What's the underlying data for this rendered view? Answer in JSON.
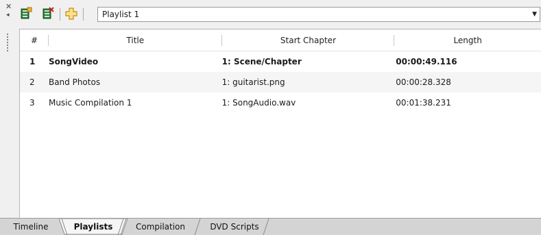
{
  "toolbar": {
    "playlist_select": "Playlist 1",
    "icons": [
      "playlist-add-icon",
      "playlist-remove-icon",
      "add-item-icon"
    ]
  },
  "table": {
    "columns": [
      "#",
      "Title",
      "Start Chapter",
      "Length"
    ],
    "rows": [
      {
        "num": "1",
        "title": "SongVideo",
        "chapter": "1: Scene/Chapter",
        "length": "00:00:49.116"
      },
      {
        "num": "2",
        "title": "Band Photos",
        "chapter": "1: guitarist.png",
        "length": "00:00:28.328"
      },
      {
        "num": "3",
        "title": "Music Compilation 1",
        "chapter": "1: SongAudio.wav",
        "length": "00:01:38.231"
      }
    ]
  },
  "tabs": [
    "Timeline",
    "Playlists",
    "Compilation",
    "DVD Scripts"
  ],
  "colors": {
    "accent_green": "#3a9a4a",
    "accent_yellow": "#f0b030",
    "selected_row_bg": "#ffffff",
    "alt_row_bg": "#f5f5f5"
  }
}
